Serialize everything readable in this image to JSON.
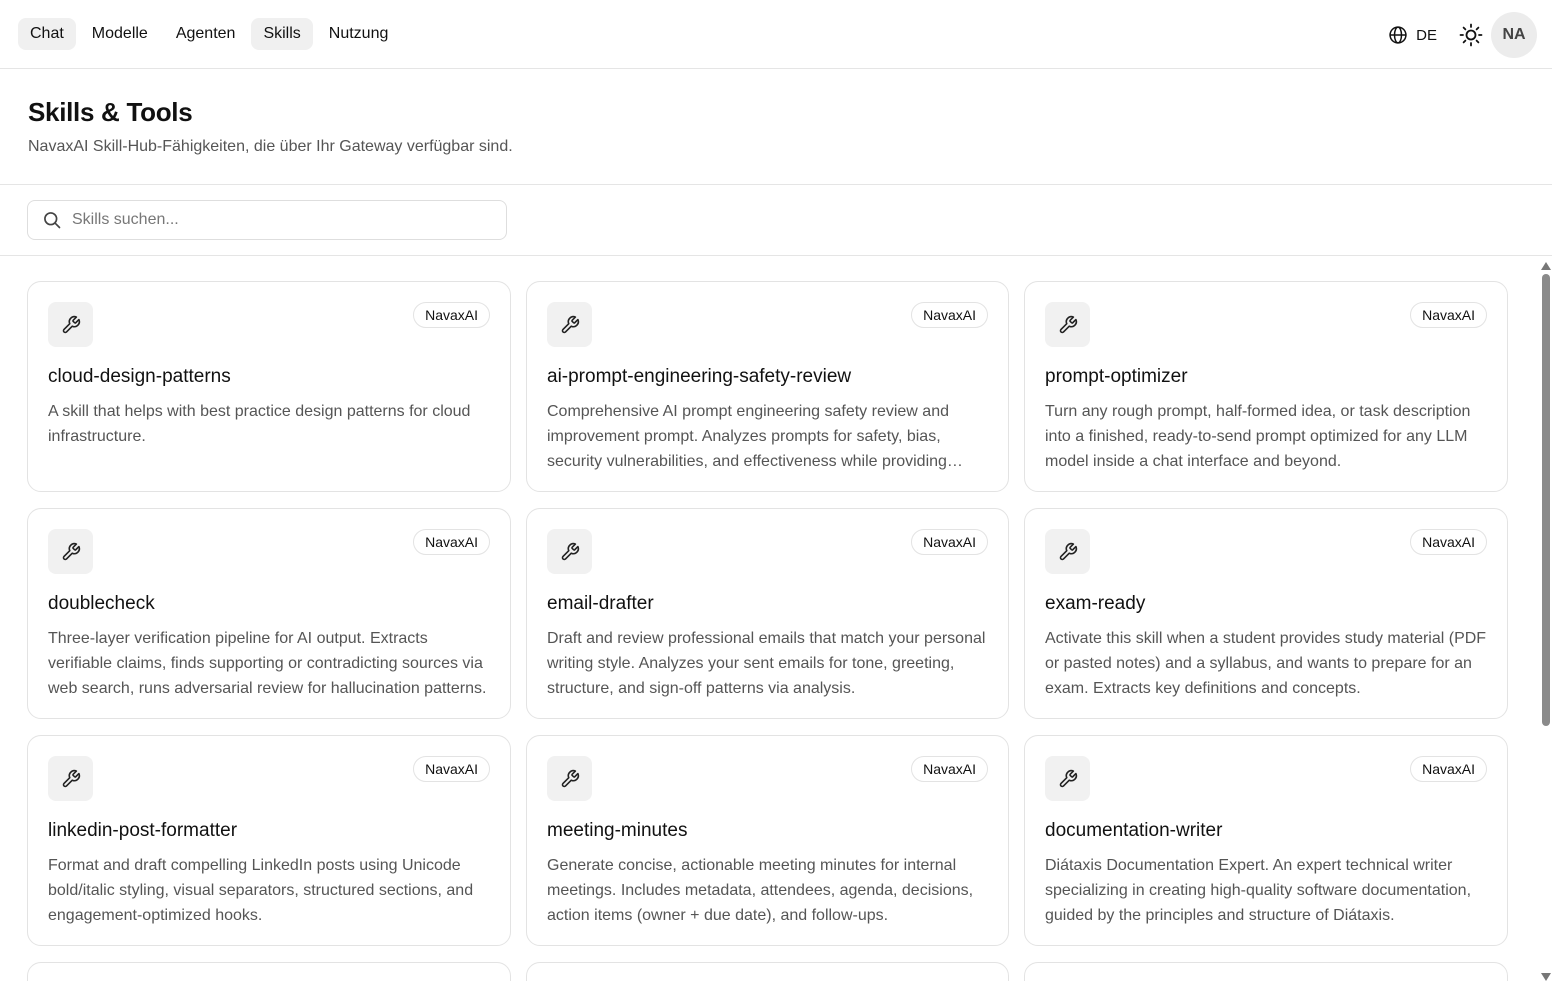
{
  "nav": {
    "tabs": [
      {
        "label": "Chat",
        "active": true
      },
      {
        "label": "Modelle",
        "active": false
      },
      {
        "label": "Agenten",
        "active": false
      },
      {
        "label": "Skills",
        "active": true
      },
      {
        "label": "Nutzung",
        "active": false
      }
    ]
  },
  "topright": {
    "language": "DE",
    "language_icon": "globe-icon",
    "theme_icon": "sun-icon",
    "avatar_initials": "NA"
  },
  "header": {
    "title": "Skills & Tools",
    "subtitle": "NavaxAI Skill-Hub-Fähigkeiten, die über Ihr Gateway verfügbar sind."
  },
  "search": {
    "placeholder": "Skills suchen...",
    "value": "",
    "icon": "search-icon"
  },
  "card_icon": "wrench-icon",
  "skills": [
    {
      "name": "cloud-design-patterns",
      "badge": "NavaxAI",
      "description": "A skill that helps with best practice design patterns for cloud infrastructure."
    },
    {
      "name": "ai-prompt-engineering-safety-review",
      "badge": "NavaxAI",
      "description": "Comprehensive AI prompt engineering safety review and improvement prompt. Analyzes prompts for safety, bias, security vulnerabilities, and effectiveness while providing detailed improvement recommendations."
    },
    {
      "name": "prompt-optimizer",
      "badge": "NavaxAI",
      "description": "Turn any rough prompt, half-formed idea, or task description into a finished, ready-to-send prompt optimized for any LLM model inside a chat interface and beyond."
    },
    {
      "name": "doublecheck",
      "badge": "NavaxAI",
      "description": "Three-layer verification pipeline for AI output. Extracts verifiable claims, finds supporting or contradicting sources via web search, runs adversarial review for hallucination patterns."
    },
    {
      "name": "email-drafter",
      "badge": "NavaxAI",
      "description": "Draft and review professional emails that match your personal writing style. Analyzes your sent emails for tone, greeting, structure, and sign-off patterns via analysis."
    },
    {
      "name": "exam-ready",
      "badge": "NavaxAI",
      "description": "Activate this skill when a student provides study material (PDF or pasted notes) and a syllabus, and wants to prepare for an exam. Extracts key definitions and concepts."
    },
    {
      "name": "linkedin-post-formatter",
      "badge": "NavaxAI",
      "description": "Format and draft compelling LinkedIn posts using Unicode bold/italic styling, visual separators, structured sections, and engagement-optimized hooks."
    },
    {
      "name": "meeting-minutes",
      "badge": "NavaxAI",
      "description": "Generate concise, actionable meeting minutes for internal meetings. Includes metadata, attendees, agenda, decisions, action items (owner + due date), and follow-ups."
    },
    {
      "name": "documentation-writer",
      "badge": "NavaxAI",
      "description": "Diátaxis Documentation Expert. An expert technical writer specializing in creating high-quality software documentation, guided by the principles and structure of Diátaxis."
    }
  ]
}
